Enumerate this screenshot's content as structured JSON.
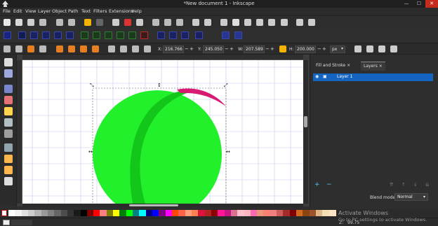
{
  "window": {
    "title": "*New document 1 - Inkscape",
    "minimize": "—",
    "maximize": "☐",
    "close": "✕"
  },
  "menu": [
    "File",
    "Edit",
    "View",
    "Layer",
    "Object",
    "Path",
    "Text",
    "Filters",
    "Extensions",
    "Help"
  ],
  "props": {
    "x_label": "X:",
    "x_value": "216.766",
    "y_label": "Y:",
    "y_value": "245.050",
    "w_label": "W:",
    "w_value": "207.589",
    "h_label": "H:",
    "h_value": "200.000",
    "unit": "px",
    "minus": "−",
    "plus": "+"
  },
  "panel": {
    "tab_fill_stroke": "Fill and Stroke",
    "tab_layers": "Layers",
    "tab_close": "×",
    "layer_name": "Layer 1",
    "add": "+",
    "remove": "−",
    "blend_label": "Blend mode:",
    "blend_value": "Normal"
  },
  "statusbar": {
    "zoom_label": "Z:",
    "zoom_value": "99.75"
  },
  "watermark": {
    "title": "Activate Windows",
    "subtitle": "Go to PC settings to activate Windows."
  },
  "colors": {
    "circle": "#22f02b",
    "crescent": "#12c71a",
    "arc": "#d91a72",
    "selection": "#1565c0"
  },
  "palette": [
    "#ffffff",
    "#f2f2f2",
    "#e0e0e0",
    "#cccccc",
    "#b3b3b3",
    "#999999",
    "#808080",
    "#666666",
    "#4d4d4d",
    "#333333",
    "#1a1a1a",
    "#000000",
    "#800000",
    "#ff0000",
    "#ff8080",
    "#808000",
    "#ffff00",
    "#008000",
    "#00ff00",
    "#008080",
    "#00ffff",
    "#000080",
    "#0000ff",
    "#800080",
    "#ff00ff",
    "#ff4500",
    "#ff6347",
    "#ffa07a",
    "#ff7f50",
    "#dc143c",
    "#b22222",
    "#8b0000",
    "#ff1493",
    "#c71585",
    "#db7093",
    "#ffc0cb",
    "#ffb6c1",
    "#ff69b4",
    "#e9967a",
    "#fa8072",
    "#f08080",
    "#cd5c5c",
    "#a52a2a",
    "#800000",
    "#d2691e",
    "#8b4513",
    "#a0522d",
    "#deb887",
    "#f5deb3",
    "#ffe4c4"
  ]
}
